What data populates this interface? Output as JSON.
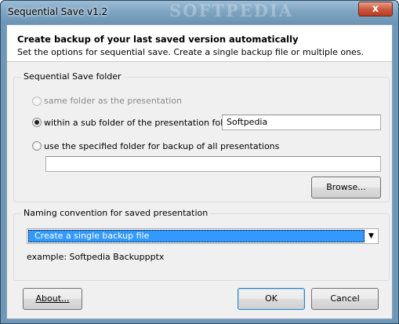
{
  "window": {
    "title": "Sequential Save v1.2",
    "watermark": "SOFTPEDIA",
    "close_glyph": "x"
  },
  "header": {
    "title": "Create backup of your last saved version automatically",
    "subtitle": "Set the options for sequential save. Create a single backup file or multiple ones."
  },
  "folder_group": {
    "legend": "Sequential Save folder",
    "options": [
      {
        "label": "same folder as the presentation",
        "checked": false,
        "enabled": false
      },
      {
        "label": "within a sub folder of the presentation folder",
        "checked": true,
        "enabled": true
      },
      {
        "label": "use the specified folder for backup of all presentations",
        "checked": false,
        "enabled": true
      }
    ],
    "subfolder_value": "Softpedia",
    "specified_folder_value": "",
    "browse_label": "Browse..."
  },
  "naming_group": {
    "legend": "Naming convention for saved presentation",
    "selected": "Create a single backup file",
    "example": "example: Softpedia Backuppptx"
  },
  "footer": {
    "about_label": "About...",
    "ok_label": "OK",
    "cancel_label": "Cancel"
  }
}
